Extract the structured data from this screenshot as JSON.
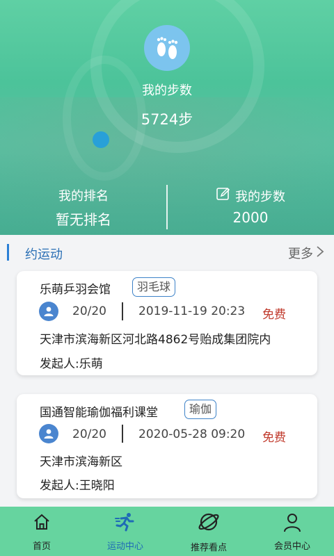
{
  "header": {
    "my_steps_label": "我的步数",
    "my_steps_value": "5724步",
    "rank_label": "我的排名",
    "rank_value": "暂无排名",
    "goal_label": "我的步数",
    "goal_value": "2000"
  },
  "section": {
    "title": "约运动",
    "more_label": "更多"
  },
  "activities": [
    {
      "title": "乐萌乒羽会馆",
      "tag": "羽毛球",
      "count": "20/20",
      "time": "2019-11-19 20:23",
      "price": "免费",
      "address": "天津市滨海新区河北路4862号贻成集团院内",
      "organizer": "发起人:乐萌"
    },
    {
      "title": "国通智能瑜伽福利课堂",
      "tag": "瑜伽",
      "count": "20/20",
      "time": "2020-05-28 09:20",
      "price": "免费",
      "address": "天津市滨海新区",
      "organizer": "发起人:王晓阳"
    }
  ],
  "nav": {
    "items": [
      {
        "label": "首页",
        "icon": "home-icon"
      },
      {
        "label": "运动中心",
        "icon": "running-icon"
      },
      {
        "label": "推荐看点",
        "icon": "planet-icon"
      },
      {
        "label": "会员中心",
        "icon": "user-icon"
      }
    ],
    "active_index": 1
  },
  "colors": {
    "header_green": "#4cc39a",
    "nav_green": "#66d49f",
    "accent_blue": "#2b7fd6",
    "price_red": "#c0392b"
  }
}
